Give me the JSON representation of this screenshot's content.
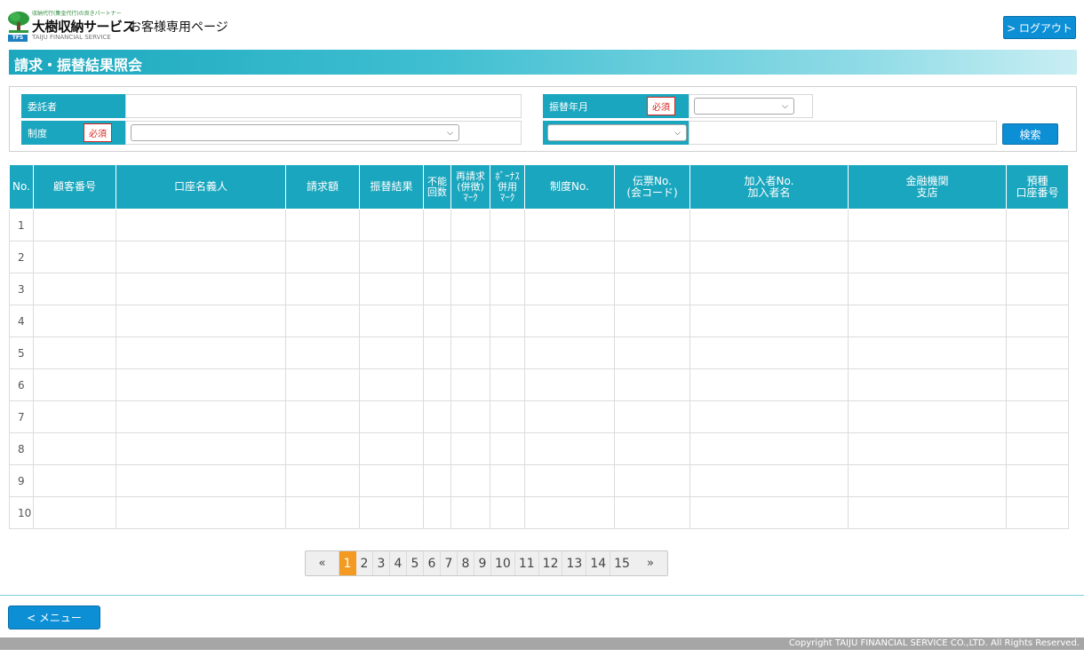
{
  "header": {
    "logo_tagline": "収納代行(集金代行)の良きパートナー",
    "logo_name": "大樹収納サービス",
    "logo_page": "お客様専用ページ",
    "logo_badge": "TFS",
    "logo_en": "TAIJU FINANCIAL SERVICE",
    "logout_label": "> ログアウト"
  },
  "page_title": "請求・振替結果照会",
  "search": {
    "itakusha_label": "委託者",
    "itakusha_value": "",
    "seido_label": "制度",
    "furikae_label": "振替年月",
    "required_label": "必須",
    "seido_selected": "",
    "furikae_year_selected": "",
    "furikae_month_selected": "",
    "search_label": "検索"
  },
  "table": {
    "headers": [
      {
        "line1": "No.",
        "line2": "",
        "line3": ""
      },
      {
        "line1": "顧客番号",
        "line2": "",
        "line3": ""
      },
      {
        "line1": "口座名義人",
        "line2": "",
        "line3": ""
      },
      {
        "line1": "請求額",
        "line2": "",
        "line3": ""
      },
      {
        "line1": "振替結果",
        "line2": "",
        "line3": ""
      },
      {
        "line1": "不能",
        "line2": "回数",
        "line3": ""
      },
      {
        "line1": "再請求",
        "line2": "(併徴)",
        "line3": "ﾏｰｸ"
      },
      {
        "line1": "ﾎﾞｰﾅｽ",
        "line2": "併用",
        "line3": "ﾏｰｸ"
      },
      {
        "line1": "制度No.",
        "line2": "",
        "line3": ""
      },
      {
        "line1": "伝票No.",
        "line2": "(会コード)",
        "line3": ""
      },
      {
        "line1": "加入者No.",
        "line2": "加入者名",
        "line3": ""
      },
      {
        "line1": "金融機関",
        "line2": "支店",
        "line3": ""
      },
      {
        "line1": "預種",
        "line2": "口座番号",
        "line3": ""
      }
    ],
    "rows": [
      "1",
      "2",
      "3",
      "4",
      "5",
      "6",
      "7",
      "8",
      "9",
      "10"
    ]
  },
  "pagination": {
    "prev": "«",
    "next": "»",
    "pages": [
      "1",
      "2",
      "3",
      "4",
      "5",
      "6",
      "7",
      "8",
      "9",
      "10",
      "11",
      "12",
      "13",
      "14",
      "15"
    ],
    "current": "1"
  },
  "menu_label": "< メニュー",
  "footer": "Copyright TAIJU FINANCIAL SERVICE CO.,LTD. All Rights Reserved.",
  "colors": {
    "accent": "#1aa6be",
    "button": "#0d8fd6",
    "active_page": "#f29a21",
    "required": "#d9271f"
  },
  "icons": [
    "tree-logo-icon",
    "chevron-down-icon"
  ]
}
